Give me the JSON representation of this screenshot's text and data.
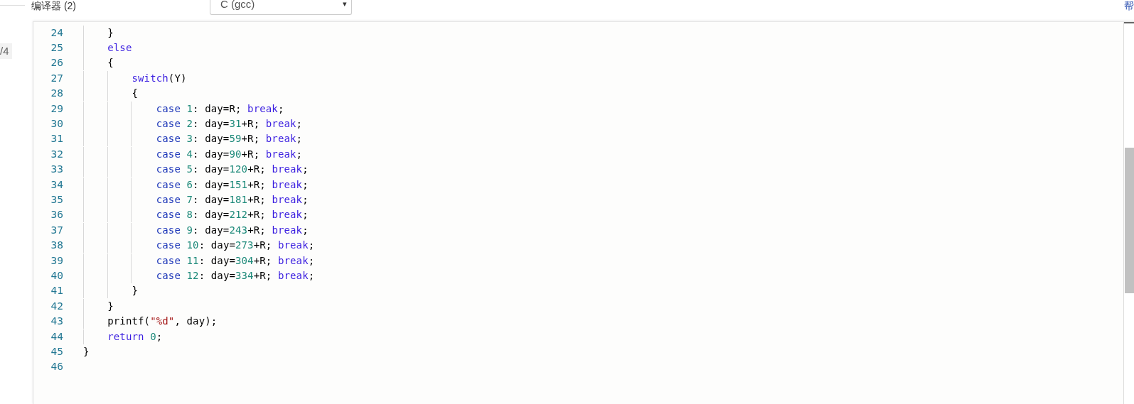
{
  "top_bar": {
    "tab_label": "编译器 (2)",
    "language_select": {
      "value": "C (gcc)",
      "caret": "▾"
    },
    "help_link": "帮"
  },
  "sidebar": {
    "page_badge": "/4"
  },
  "editor": {
    "lines": [
      {
        "number": "24",
        "tokens": [
          {
            "kind": "plain",
            "text": "    }"
          }
        ]
      },
      {
        "number": "25",
        "tokens": [
          {
            "kind": "keyword",
            "text": "    else"
          }
        ]
      },
      {
        "number": "26",
        "tokens": [
          {
            "kind": "plain",
            "text": "    {"
          }
        ]
      },
      {
        "number": "27",
        "tokens": [
          {
            "kind": "keyword",
            "text": "        switch"
          },
          {
            "kind": "plain",
            "text": "(Y)"
          }
        ]
      },
      {
        "number": "28",
        "tokens": [
          {
            "kind": "plain",
            "text": "        {"
          }
        ]
      },
      {
        "number": "29",
        "tokens": [
          {
            "kind": "label",
            "text": "            case"
          },
          {
            "kind": "number",
            "text": " 1"
          },
          {
            "kind": "plain",
            "text": ": day=R; "
          },
          {
            "kind": "keyword",
            "text": "break"
          },
          {
            "kind": "plain",
            "text": ";"
          }
        ]
      },
      {
        "number": "30",
        "tokens": [
          {
            "kind": "label",
            "text": "            case"
          },
          {
            "kind": "number",
            "text": " 2"
          },
          {
            "kind": "plain",
            "text": ": day="
          },
          {
            "kind": "number",
            "text": "31"
          },
          {
            "kind": "plain",
            "text": "+R; "
          },
          {
            "kind": "keyword",
            "text": "break"
          },
          {
            "kind": "plain",
            "text": ";"
          }
        ]
      },
      {
        "number": "31",
        "tokens": [
          {
            "kind": "label",
            "text": "            case"
          },
          {
            "kind": "number",
            "text": " 3"
          },
          {
            "kind": "plain",
            "text": ": day="
          },
          {
            "kind": "number",
            "text": "59"
          },
          {
            "kind": "plain",
            "text": "+R; "
          },
          {
            "kind": "keyword",
            "text": "break"
          },
          {
            "kind": "plain",
            "text": ";"
          }
        ]
      },
      {
        "number": "32",
        "tokens": [
          {
            "kind": "label",
            "text": "            case"
          },
          {
            "kind": "number",
            "text": " 4"
          },
          {
            "kind": "plain",
            "text": ": day="
          },
          {
            "kind": "number",
            "text": "90"
          },
          {
            "kind": "plain",
            "text": "+R; "
          },
          {
            "kind": "keyword",
            "text": "break"
          },
          {
            "kind": "plain",
            "text": ";"
          }
        ]
      },
      {
        "number": "33",
        "tokens": [
          {
            "kind": "label",
            "text": "            case"
          },
          {
            "kind": "number",
            "text": " 5"
          },
          {
            "kind": "plain",
            "text": ": day="
          },
          {
            "kind": "number",
            "text": "120"
          },
          {
            "kind": "plain",
            "text": "+R; "
          },
          {
            "kind": "keyword",
            "text": "break"
          },
          {
            "kind": "plain",
            "text": ";"
          }
        ]
      },
      {
        "number": "34",
        "tokens": [
          {
            "kind": "label",
            "text": "            case"
          },
          {
            "kind": "number",
            "text": " 6"
          },
          {
            "kind": "plain",
            "text": ": day="
          },
          {
            "kind": "number",
            "text": "151"
          },
          {
            "kind": "plain",
            "text": "+R; "
          },
          {
            "kind": "keyword",
            "text": "break"
          },
          {
            "kind": "plain",
            "text": ";"
          }
        ]
      },
      {
        "number": "35",
        "tokens": [
          {
            "kind": "label",
            "text": "            case"
          },
          {
            "kind": "number",
            "text": " 7"
          },
          {
            "kind": "plain",
            "text": ": day="
          },
          {
            "kind": "number",
            "text": "181"
          },
          {
            "kind": "plain",
            "text": "+R; "
          },
          {
            "kind": "keyword",
            "text": "break"
          },
          {
            "kind": "plain",
            "text": ";"
          }
        ]
      },
      {
        "number": "36",
        "tokens": [
          {
            "kind": "label",
            "text": "            case"
          },
          {
            "kind": "number",
            "text": " 8"
          },
          {
            "kind": "plain",
            "text": ": day="
          },
          {
            "kind": "number",
            "text": "212"
          },
          {
            "kind": "plain",
            "text": "+R; "
          },
          {
            "kind": "keyword",
            "text": "break"
          },
          {
            "kind": "plain",
            "text": ";"
          }
        ]
      },
      {
        "number": "37",
        "tokens": [
          {
            "kind": "label",
            "text": "            case"
          },
          {
            "kind": "number",
            "text": " 9"
          },
          {
            "kind": "plain",
            "text": ": day="
          },
          {
            "kind": "number",
            "text": "243"
          },
          {
            "kind": "plain",
            "text": "+R; "
          },
          {
            "kind": "keyword",
            "text": "break"
          },
          {
            "kind": "plain",
            "text": ";"
          }
        ]
      },
      {
        "number": "38",
        "tokens": [
          {
            "kind": "label",
            "text": "            case"
          },
          {
            "kind": "number",
            "text": " 10"
          },
          {
            "kind": "plain",
            "text": ": day="
          },
          {
            "kind": "number",
            "text": "273"
          },
          {
            "kind": "plain",
            "text": "+R; "
          },
          {
            "kind": "keyword",
            "text": "break"
          },
          {
            "kind": "plain",
            "text": ";"
          }
        ]
      },
      {
        "number": "39",
        "tokens": [
          {
            "kind": "label",
            "text": "            case"
          },
          {
            "kind": "number",
            "text": " 11"
          },
          {
            "kind": "plain",
            "text": ": day="
          },
          {
            "kind": "number",
            "text": "304"
          },
          {
            "kind": "plain",
            "text": "+R; "
          },
          {
            "kind": "keyword",
            "text": "break"
          },
          {
            "kind": "plain",
            "text": ";"
          }
        ]
      },
      {
        "number": "40",
        "tokens": [
          {
            "kind": "label",
            "text": "            case"
          },
          {
            "kind": "number",
            "text": " 12"
          },
          {
            "kind": "plain",
            "text": ": day="
          },
          {
            "kind": "number",
            "text": "334"
          },
          {
            "kind": "plain",
            "text": "+R; "
          },
          {
            "kind": "keyword",
            "text": "break"
          },
          {
            "kind": "plain",
            "text": ";"
          }
        ]
      },
      {
        "number": "41",
        "tokens": [
          {
            "kind": "plain",
            "text": "        }"
          }
        ]
      },
      {
        "number": "42",
        "tokens": [
          {
            "kind": "plain",
            "text": "    }"
          }
        ]
      },
      {
        "number": "43",
        "tokens": [
          {
            "kind": "plain",
            "text": "    printf("
          },
          {
            "kind": "string",
            "text": "\"%d\""
          },
          {
            "kind": "plain",
            "text": ", day);"
          }
        ]
      },
      {
        "number": "44",
        "tokens": [
          {
            "kind": "keyword",
            "text": "    return"
          },
          {
            "kind": "number",
            "text": " 0"
          },
          {
            "kind": "plain",
            "text": ";"
          }
        ]
      },
      {
        "number": "45",
        "tokens": [
          {
            "kind": "plain",
            "text": "}"
          }
        ]
      },
      {
        "number": "46"
      }
    ]
  }
}
